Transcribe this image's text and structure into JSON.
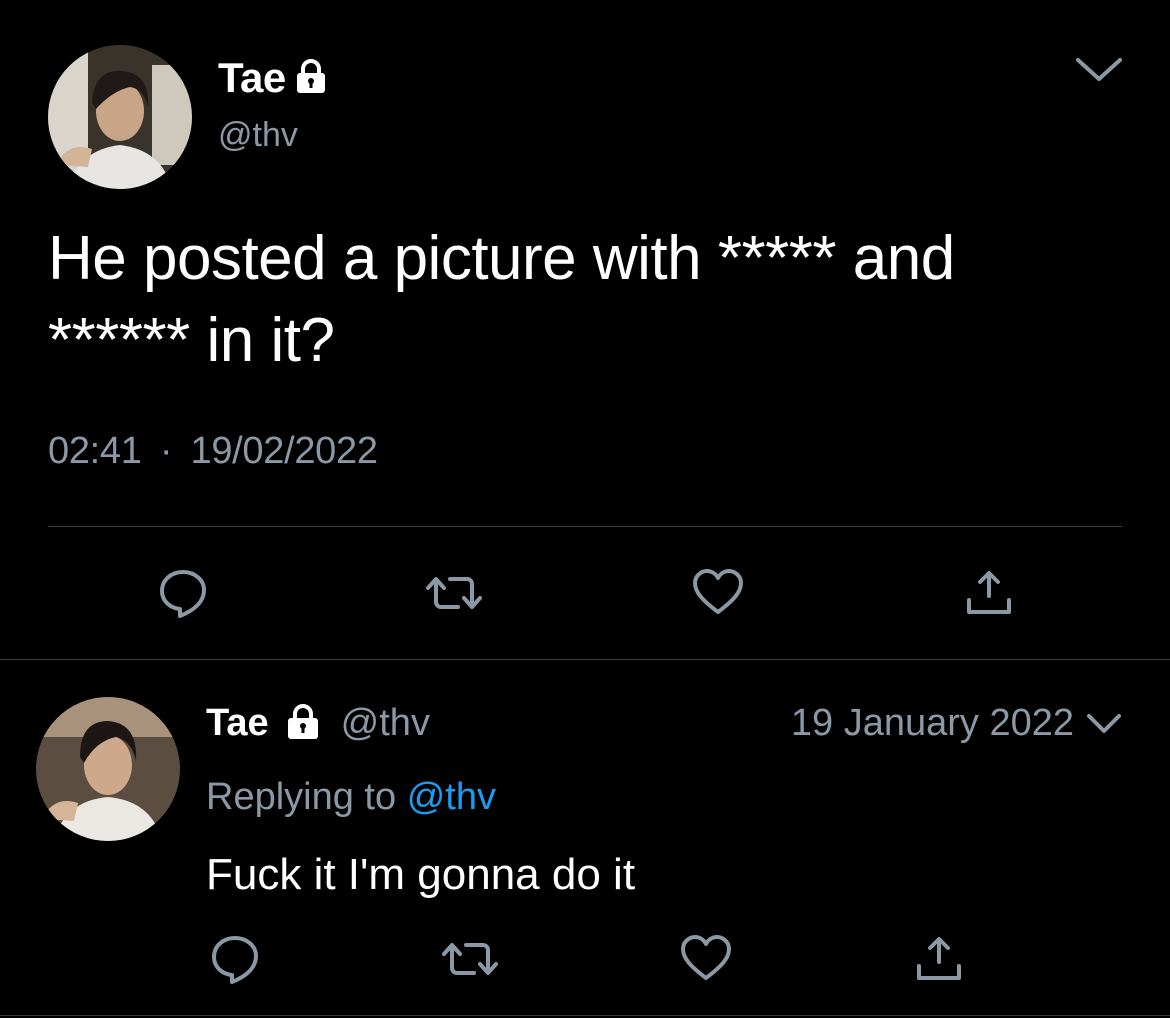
{
  "theme": {
    "background": "#000000",
    "text": "#ffffff",
    "secondary_text": "#8b98a5",
    "accent": "#1d9bf0",
    "divider": "#3a3d42"
  },
  "main_tweet": {
    "author_name": "Tae",
    "author_handle": "@thv",
    "protected_icon": "lock-icon",
    "text": "He posted a picture with ***** and\n****** in it?",
    "time": "02:41",
    "separator": "·",
    "date": "19/02/2022",
    "actions": [
      {
        "name": "reply",
        "icon": "comment-icon"
      },
      {
        "name": "retweet",
        "icon": "retweet-icon"
      },
      {
        "name": "like",
        "icon": "heart-icon"
      },
      {
        "name": "share",
        "icon": "share-icon"
      }
    ],
    "menu_icon": "chevron-down-icon"
  },
  "reply_tweet": {
    "author_name": "Tae",
    "author_handle": "@thv",
    "protected_icon": "lock-icon",
    "date": "19 January 2022",
    "replying_to_label": "Replying to",
    "replying_to_handle": "@thv",
    "text": "Fuck it I'm gonna do it",
    "actions": [
      {
        "name": "reply",
        "icon": "comment-icon"
      },
      {
        "name": "retweet",
        "icon": "retweet-icon"
      },
      {
        "name": "like",
        "icon": "heart-icon"
      },
      {
        "name": "share",
        "icon": "share-icon"
      }
    ],
    "menu_icon": "chevron-down-icon"
  }
}
